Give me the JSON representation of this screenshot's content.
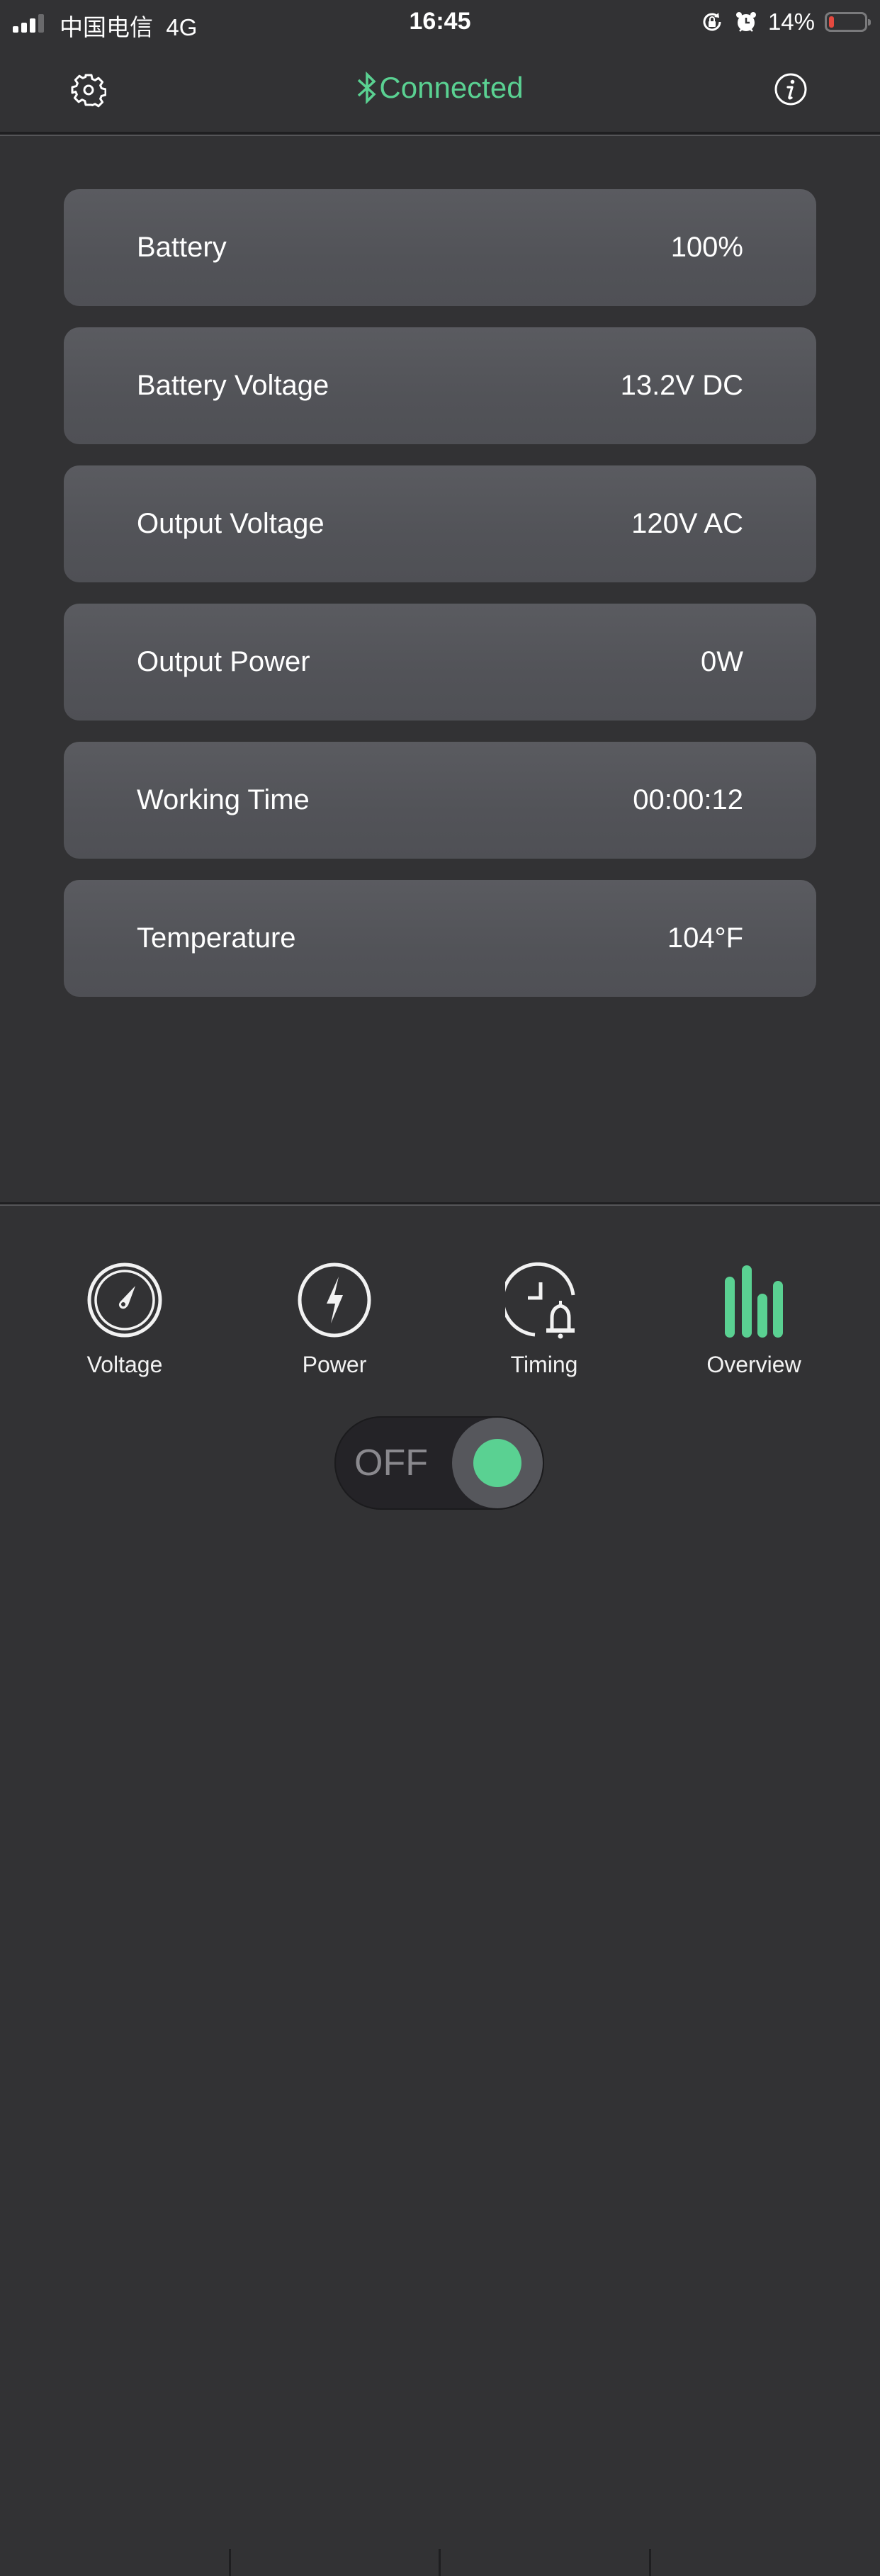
{
  "status_bar": {
    "carrier": "中国电信",
    "network": "4G",
    "time": "16:45",
    "battery_percent_label": "14%",
    "battery_level": 0.14,
    "icons": [
      "signal-icon",
      "rotation-lock-icon",
      "alarm-icon",
      "battery-icon"
    ]
  },
  "header": {
    "title": "Connected",
    "title_color": "#5ad192",
    "left_icon": "gear-icon",
    "title_icon": "bluetooth-icon",
    "right_icon": "info-icon"
  },
  "metrics": [
    {
      "label": "Battery",
      "value": "100%"
    },
    {
      "label": "Battery Voltage",
      "value": "13.2V DC"
    },
    {
      "label": "Output Voltage",
      "value": "120V AC"
    },
    {
      "label": "Output Power",
      "value": "0W"
    },
    {
      "label": "Working Time",
      "value": "00:00:12"
    },
    {
      "label": "Temperature",
      "value": "104°F"
    }
  ],
  "tabs": [
    {
      "label": "Voltage",
      "icon": "gauge-icon",
      "active": false
    },
    {
      "label": "Power",
      "icon": "lightning-icon",
      "active": false
    },
    {
      "label": "Timing",
      "icon": "clock-bell-icon",
      "active": false
    },
    {
      "label": "Overview",
      "icon": "bar-chart-icon",
      "active": true
    }
  ],
  "power_toggle": {
    "label": "OFF",
    "state": "off"
  },
  "colors": {
    "accent": "#5ad192",
    "background": "#323234",
    "card": "#55565b",
    "battery_low": "#e5493f"
  }
}
